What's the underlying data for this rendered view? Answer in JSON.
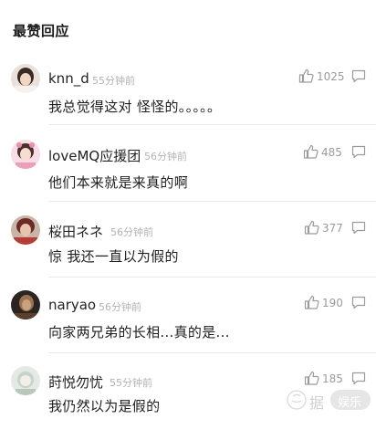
{
  "section": {
    "title": "最赞回应"
  },
  "comments": [
    {
      "username": "knn_d",
      "time": "55分钟前",
      "likes": "1025",
      "text": "我总觉得这对 怪怪的。。。。。",
      "avatar_icon": "avatar-photo-dark-hair"
    },
    {
      "username": "loveMQ应援团",
      "time": "56分钟前",
      "likes": "485",
      "text": "他们本来就是来真的啊",
      "avatar_icon": "avatar-photo-pink"
    },
    {
      "username": "桜田ネネ",
      "time": "56分钟前",
      "likes": "377",
      "text": "惊 我还一直以为假的",
      "avatar_icon": "avatar-photo-red"
    },
    {
      "username": "naryao",
      "time": "56分钟前",
      "likes": "190",
      "text": "向家两兄弟的长相...真的是...",
      "avatar_icon": "avatar-photo-brown"
    },
    {
      "username": "莳悦勿忧",
      "time": "55分钟前",
      "likes": "185",
      "text": "我仍然以为是假的",
      "avatar_icon": "avatar-photo-light"
    }
  ],
  "watermark": {
    "text_left": "据",
    "text_badge": "娱乐"
  },
  "colors": {
    "divider": "#e8e8e8",
    "meta_gray": "#b3b3b3",
    "count_gray": "#9b9b9b"
  }
}
